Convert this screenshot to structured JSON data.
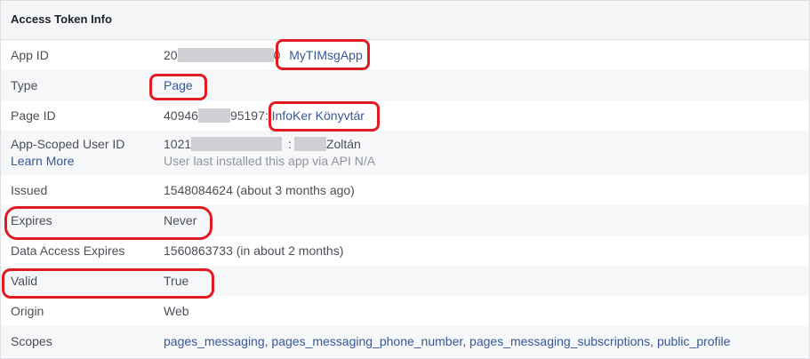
{
  "panel": {
    "title": "Access Token Info"
  },
  "rows": {
    "app_id": {
      "label": "App ID",
      "id_prefix": "20",
      "id_suffix": "0",
      "app_name": "MyTIMsgApp"
    },
    "type": {
      "label": "Type",
      "value": "Page"
    },
    "page_id": {
      "label": "Page ID",
      "id_prefix": "40946",
      "id_suffix": "95197",
      "sep": ":",
      "page_name": "InfoKer Könyvtár"
    },
    "app_scoped_user_id": {
      "label": "App-Scoped User ID",
      "learn_more": "Learn More",
      "id_prefix": "1021",
      "sep": ":",
      "user_name": "Zoltán",
      "note": "User last installed this app via API N/A"
    },
    "issued": {
      "label": "Issued",
      "value": "1548084624 (about 3 months ago)"
    },
    "expires": {
      "label": "Expires",
      "value": "Never"
    },
    "data_access_expires": {
      "label": "Data Access Expires",
      "value": "1560863733 (in about 2 months)"
    },
    "valid": {
      "label": "Valid",
      "value": "True"
    },
    "origin": {
      "label": "Origin",
      "value": "Web"
    },
    "scopes": {
      "label": "Scopes",
      "items": [
        "pages_messaging",
        "pages_messaging_phone_number",
        "pages_messaging_subscriptions",
        "public_profile"
      ],
      "sep": ","
    }
  },
  "colors": {
    "annotation": "#e01b22",
    "link": "#365899",
    "row_alt": "#f6f7f9"
  }
}
